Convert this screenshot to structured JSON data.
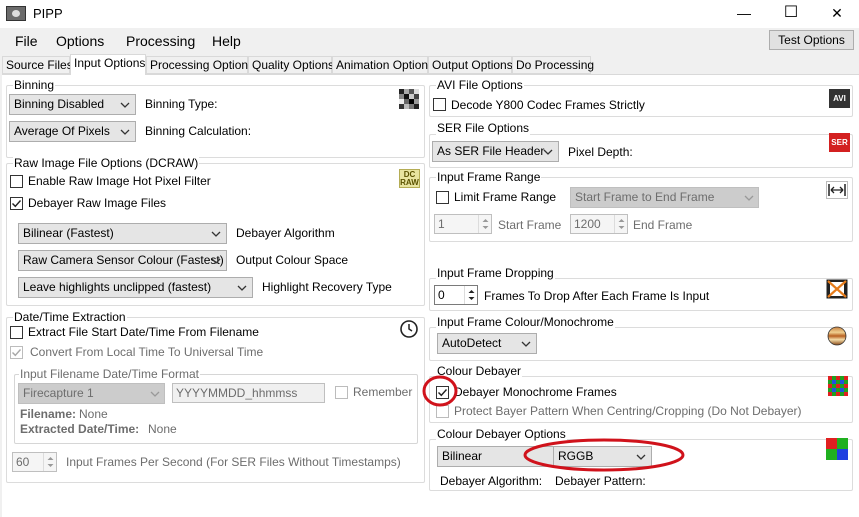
{
  "window": {
    "title": "PIPP",
    "minimize": "—",
    "maximize": "☐",
    "close": "✕"
  },
  "menu": {
    "file": "File",
    "options": "Options",
    "processing": "Processing",
    "help": "Help",
    "test_options": "Test Options"
  },
  "tabs": [
    "Source Files",
    "Input Options",
    "Processing Options",
    "Quality Options",
    "Animation Options",
    "Output Options",
    "Do Processing"
  ],
  "binning": {
    "title": "Binning",
    "type_value": "Binning Disabled",
    "type_label": "Binning Type:",
    "calc_value": "Average Of Pixels",
    "calc_label": "Binning Calculation:"
  },
  "raw": {
    "title": "Raw Image File Options (DCRAW)",
    "hot_pixel": "Enable Raw Image Hot Pixel Filter",
    "debayer_raw": "Debayer Raw Image Files",
    "algo_value": "Bilinear (Fastest)",
    "algo_label": "Debayer Algorithm",
    "colour_value": "Raw Camera Sensor Colour (Fastest)",
    "colour_label": "Output Colour Space",
    "highlight_value": "Leave highlights unclipped (fastest)",
    "highlight_label": "Highlight Recovery Type",
    "icon_text_1": "DC",
    "icon_text_2": "RAW"
  },
  "datetime": {
    "title": "Date/Time Extraction",
    "extract": "Extract File Start Date/Time From Filename",
    "convert": "Convert From Local Time To Universal Time",
    "format_title": "Input Filename Date/Time Format",
    "format_value": "Firecapture 1",
    "format_text": "YYYYMMDD_hhmmss",
    "remember": "Remember",
    "filename_label": "Filename:",
    "filename_value": "None",
    "extracted_label": "Extracted Date/Time:",
    "extracted_value": "None",
    "fps_value": "60",
    "fps_label": "Input Frames Per Second (For SER Files Without Timestamps)"
  },
  "avi": {
    "title": "AVI File Options",
    "y800": "Decode Y800 Codec Frames Strictly",
    "icon_text": "AVI"
  },
  "ser": {
    "title": "SER File Options",
    "depth_value": "As SER File Header",
    "depth_label": "Pixel Depth:",
    "icon_text": "SER"
  },
  "frame_range": {
    "title": "Input Frame Range",
    "limit": "Limit Frame Range",
    "range_value": "Start Frame to End Frame",
    "start_value": "1",
    "start_label": "Start Frame",
    "end_value": "1200",
    "end_label": "End Frame"
  },
  "dropping": {
    "title": "Input Frame Dropping",
    "value": "0",
    "label": "Frames To Drop After Each Frame Is Input"
  },
  "colour_mono": {
    "title": "Input Frame Colour/Monochrome",
    "value": "AutoDetect"
  },
  "colour_debayer": {
    "title": "Colour Debayer",
    "debayer_mono": "Debayer Monochrome Frames",
    "protect": "Protect Bayer Pattern When Centring/Cropping (Do Not Debayer)"
  },
  "debayer_options": {
    "title": "Colour Debayer Options",
    "algo_value": "Bilinear",
    "algo_label": "Debayer Algorithm:",
    "pattern_value": "RGGB",
    "pattern_label": "Debayer Pattern:"
  },
  "colors": {
    "highlight_circle": "#d0121b",
    "accent": "#0078d7"
  }
}
